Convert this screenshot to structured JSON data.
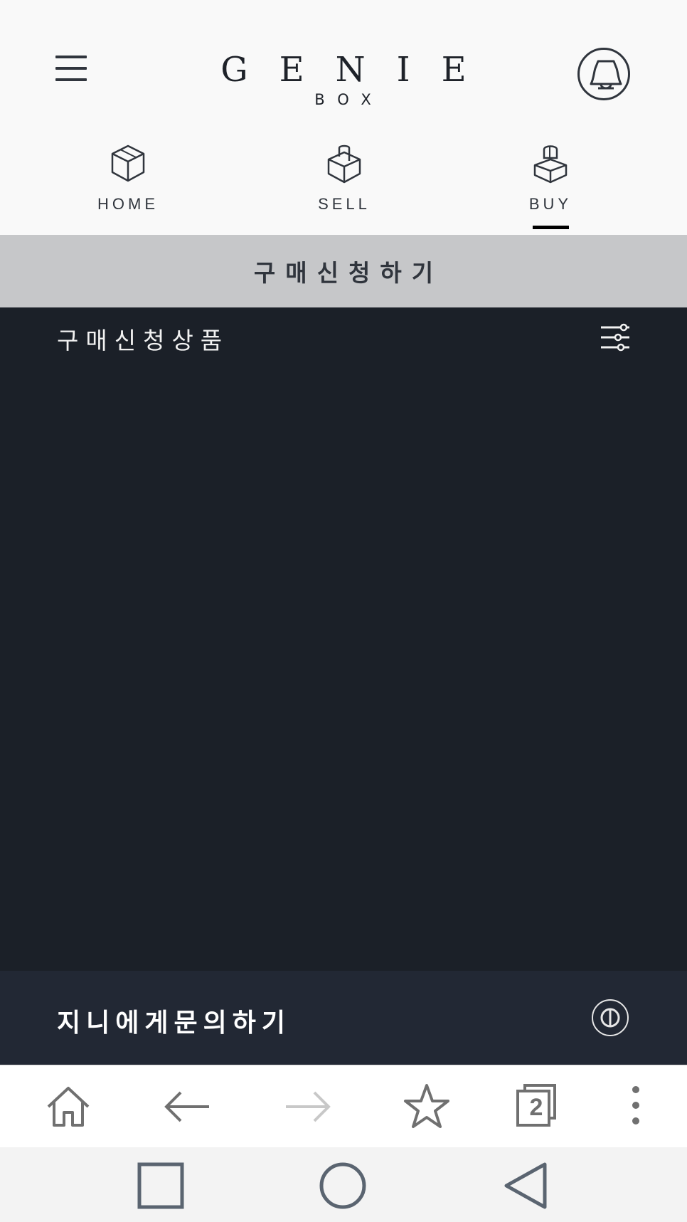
{
  "header": {
    "logo_main": "GENIE",
    "logo_sub": "BOX"
  },
  "nav": {
    "items": [
      {
        "label": "HOME",
        "icon": "box-icon"
      },
      {
        "label": "SELL",
        "icon": "box-tag-icon"
      },
      {
        "label": "BUY",
        "icon": "box-open-icon",
        "active": true
      }
    ]
  },
  "apply": {
    "label": "구매신청하기"
  },
  "content": {
    "title": "구매신청상품",
    "filter_icon": "filter-sliders-icon"
  },
  "inquiry": {
    "label": "지니에게문의하기",
    "icon": "genie-circle-icon"
  },
  "browser_toolbar": {
    "tab_count": "2"
  },
  "colors": {
    "dark_bg": "#1b2028",
    "inquiry_bg": "#222834",
    "apply_bg": "#c6c7c9",
    "header_bg": "#f9f9f9"
  }
}
